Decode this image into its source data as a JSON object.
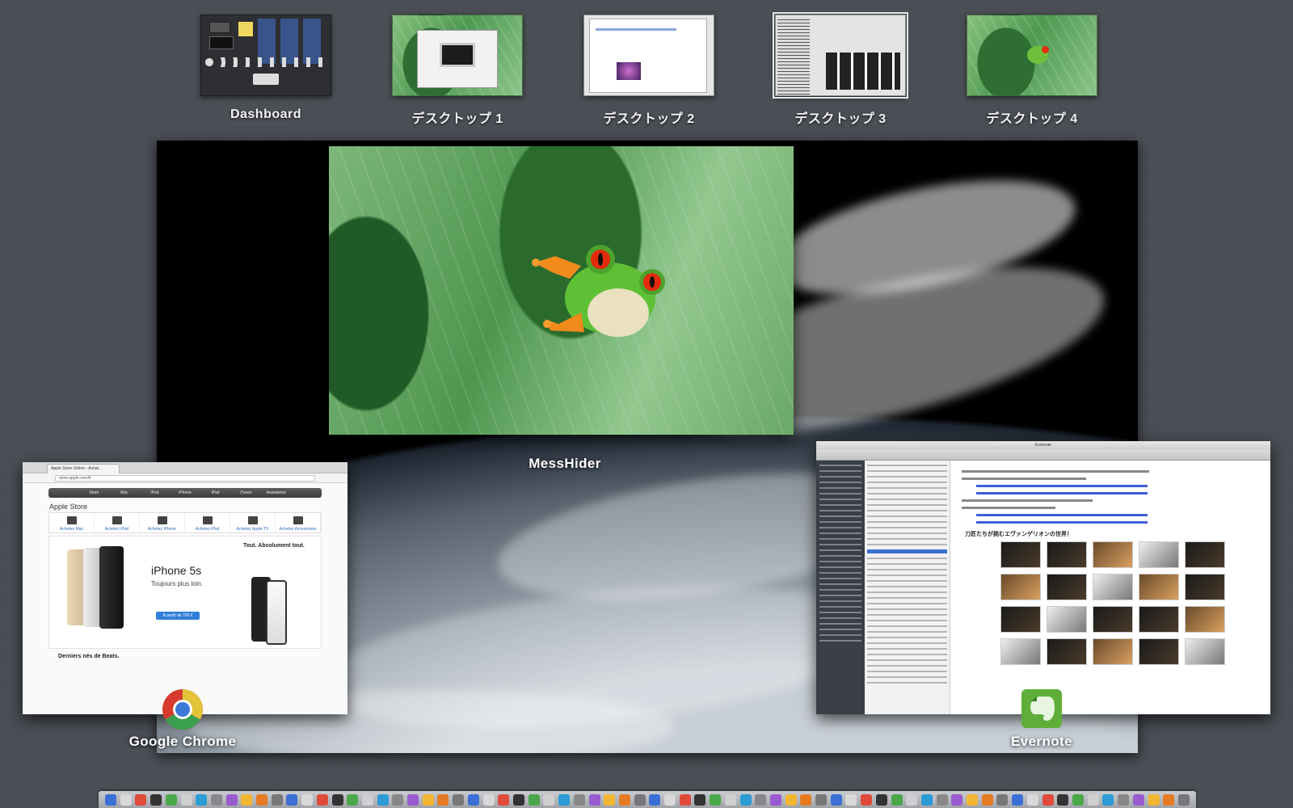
{
  "spaces": [
    {
      "label": "Dashboard",
      "active": false
    },
    {
      "label": "デスクトップ 1",
      "active": false
    },
    {
      "label": "デスクトップ 2",
      "active": false
    },
    {
      "label": "デスクトップ 3",
      "active": true
    },
    {
      "label": "デスクトップ 4",
      "active": false
    }
  ],
  "windows": {
    "messhider": {
      "app_label": "MessHider"
    },
    "chrome": {
      "app_label": "Google Chrome",
      "tab_title": "Apple Store Online - Achat...",
      "url": "store.apple.com/fr",
      "nav_items": [
        "",
        "Store",
        "Mac",
        "iPod",
        "iPhone",
        "iPad",
        "iTunes",
        "Assistance",
        ""
      ],
      "store_title": "Apple Store",
      "products": [
        "Achetez Mac",
        "Achetez iPad",
        "Achetez iPhone",
        "Achetez iPod",
        "Achetez Apple TV",
        "Achetez Accessoires"
      ],
      "hero_title": "iPhone 5s",
      "hero_sub": "Toujours plus loin.",
      "hero_button": "À partir de 709 €",
      "hero_right_title": "Tout. Absolument tout.",
      "beats_title": "Derniers nés de Beats."
    },
    "evernote": {
      "app_label": "Evernote",
      "title": "Evernote",
      "heading": "刀匠たちが挑むエヴァンゲリオンの世界！"
    }
  },
  "colors": {
    "background": "#4a4e55",
    "active_outline": "#e8e8e8",
    "label_text": "#f2f2f2"
  },
  "icons": {
    "chrome": "google-chrome-icon",
    "evernote": "evernote-icon"
  }
}
